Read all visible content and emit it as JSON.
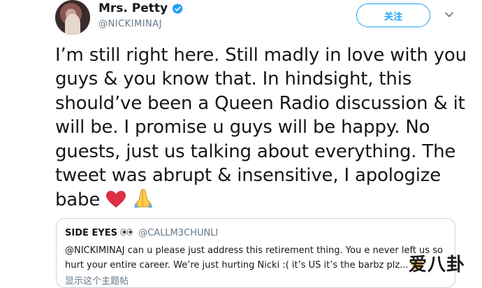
{
  "header": {
    "display_name": "Mrs. Petty",
    "handle": "@NICKIMINAJ",
    "follow_label": "关注"
  },
  "tweet": {
    "lines": [
      "I’m still right here. Still madly in love with you",
      "guys & you know that. In hindsight, this",
      "should’ve been a Queen Radio discussion & it",
      "will be. I promise u guys will be happy. No",
      "guests, just us talking about everything. The",
      "tweet was abrupt & insensitive, I apologize",
      "babe"
    ],
    "emojis": [
      "red-heart",
      "folded-hands"
    ]
  },
  "quoted_tweet": {
    "name": "SIDE EYES",
    "name_emoji": "eyes",
    "handle": "@CALLM3CHUNLI",
    "lines": [
      "@NICKIMINAJ can u please just address this retirement thing. You e never left us so",
      "hurt your entire career. We’re just hurting Nicki :( it’s US it’s the barbz plz..."
    ],
    "more_label": "显示这个主题帖"
  },
  "watermark": "爱八卦",
  "colors": {
    "accent": "#1da1f2",
    "text": "#14171a",
    "secondary": "#657786",
    "border": "#ccd6dd",
    "heart": "#dd2e44",
    "hands": "#ffcc4d"
  }
}
